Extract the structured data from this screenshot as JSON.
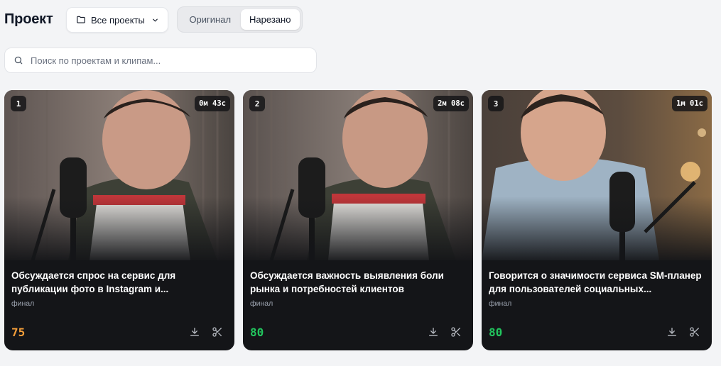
{
  "header": {
    "title": "Проект",
    "project_filter": {
      "icon": "folder-icon",
      "label": "Все проекты"
    },
    "view_toggle": {
      "options": [
        "Оригинал",
        "Нарезано"
      ],
      "selected": "Нарезано"
    }
  },
  "search": {
    "placeholder": "Поиск по проектам и клипам...",
    "value": ""
  },
  "clips": [
    {
      "index": "1",
      "duration": "0м 43с",
      "title": "Обсуждается спрос на сервис для публикации фото в Instagram и...",
      "tag": "финал",
      "score": "75",
      "score_color": "#f59e3a"
    },
    {
      "index": "2",
      "duration": "2м 08с",
      "title": "Обсуждается важность выявления боли рынка и потребностей клиентов",
      "tag": "финал",
      "score": "80",
      "score_color": "#22c55e"
    },
    {
      "index": "3",
      "duration": "1м 01с",
      "title": "Говорится о значимости сервиса SM-планер для пользователей социальных...",
      "tag": "финал",
      "score": "80",
      "score_color": "#22c55e"
    }
  ],
  "colors": {
    "background": "#f3f4f6",
    "card": "#141518",
    "score_orange": "#f59e3a",
    "score_green": "#22c55e"
  }
}
